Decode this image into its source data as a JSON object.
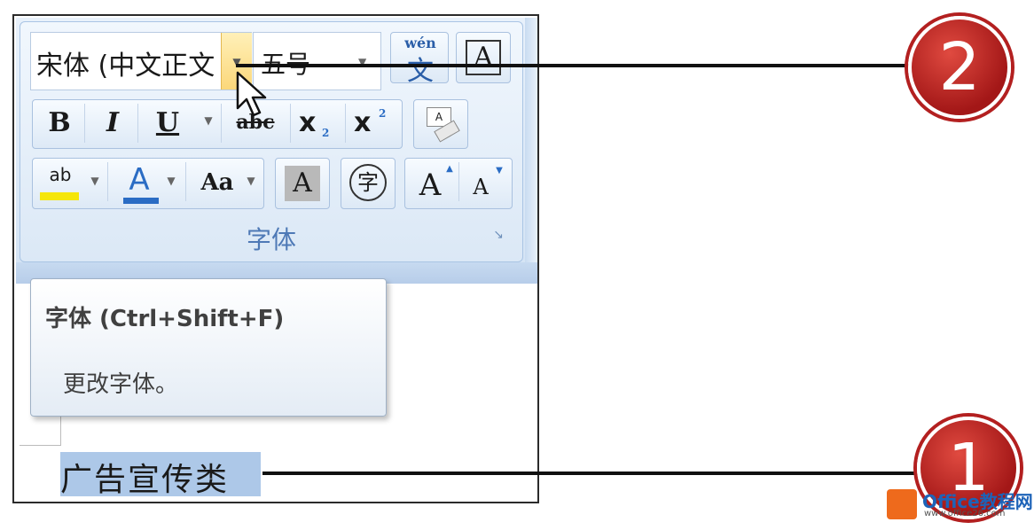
{
  "ribbon": {
    "font_name": "宋体 (中文正文",
    "font_size": "五号",
    "group_label": "字体",
    "phonetic_top": "wén",
    "phonetic_bottom": "文",
    "border_char": "A",
    "bold": "B",
    "italic": "I",
    "underline": "U",
    "strike": "abc",
    "subscript_base": "x",
    "subscript_sub": "2",
    "superscript_base": "x",
    "superscript_sup": "2",
    "clear_top": "A",
    "highlight_label": "ab",
    "font_color_label": "A",
    "change_case_label": "Aa",
    "shading_label": "A",
    "enclose_label": "字",
    "grow_label": "A",
    "shrink_label": "A",
    "colors": {
      "highlight": "#f5e60a",
      "font_color": "#2a6cc4"
    }
  },
  "tooltip": {
    "title": "字体 (Ctrl+Shift+F)",
    "description": "更改字体。"
  },
  "document": {
    "selected_text": "广告宣传类"
  },
  "callouts": [
    {
      "number": "2"
    },
    {
      "number": "1"
    }
  ],
  "watermark": {
    "name": "Office教程网",
    "url": "www.office26.com"
  }
}
